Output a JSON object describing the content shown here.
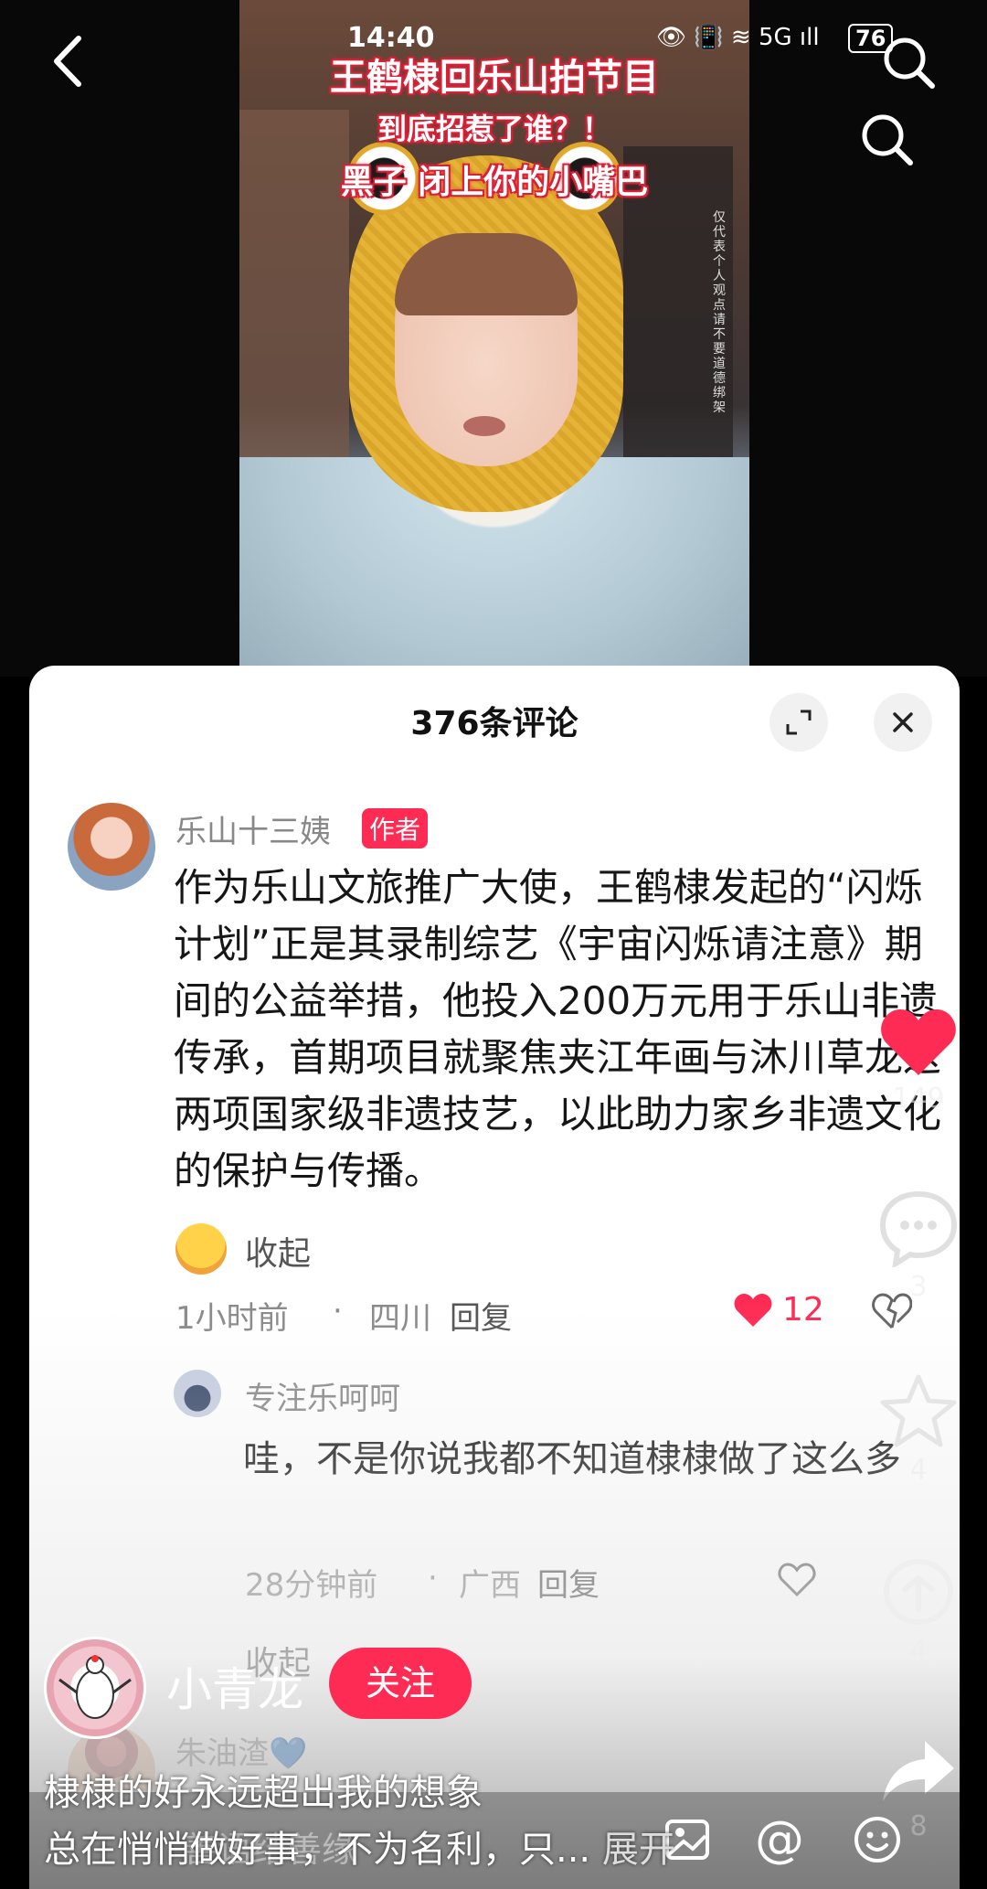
{
  "status_bar": {
    "time": "14:40",
    "icons": "👁 📳 ≋ 5G ıll",
    "battery": "76"
  },
  "video": {
    "overlay_line1": "王鹤棣回乐山拍节目",
    "overlay_line2": "到底招惹了谁？！",
    "overlay_line3": "黑子 闭上你的小嘴巴",
    "side_note": "仅代表个人观点 请不要道德绑架"
  },
  "comments_panel": {
    "title": "376条评论",
    "comments": [
      {
        "username": "乐山十三姨",
        "badge": "作者",
        "text": "作为乐山文旅推广大使，王鹤棣发起的“闪烁计划”正是其录制综艺《宇宙闪烁请注意》期间的公益举措，他投入200万元用于乐山非遗传承，首期项目就聚焦夹江年画与沐川草龙这两项国家级非遗技艺，以此助力家乡非遗文化的保护与传播。",
        "collapse_label": "收起",
        "time": "1小时前",
        "location": "四川",
        "reply_label": "回复",
        "likes": "12"
      },
      {
        "username": "专注乐呵呵",
        "text": "哇，不是你说我都不知道棣棣做了这么多",
        "time": "28分钟前",
        "location": "广西",
        "reply_label": "回复",
        "collapse_label": "收起"
      },
      {
        "username": "朱油渣💙"
      }
    ],
    "input_placeholder": "善语结善缘"
  },
  "side_actions": {
    "like_count": "149",
    "comment_count": "3",
    "favorite_count": "4",
    "more_count": "4",
    "share_count": "8"
  },
  "creator": {
    "name": "小青龙",
    "follow_label": "关注"
  },
  "caption": {
    "line1": "棣棣的好永远超出我的想象",
    "line2": "总在悄悄做好事，不为名利，只...",
    "expand_label": "展开"
  },
  "colors": {
    "accent": "#fe2c55",
    "panel_bg": "#ffffff"
  }
}
